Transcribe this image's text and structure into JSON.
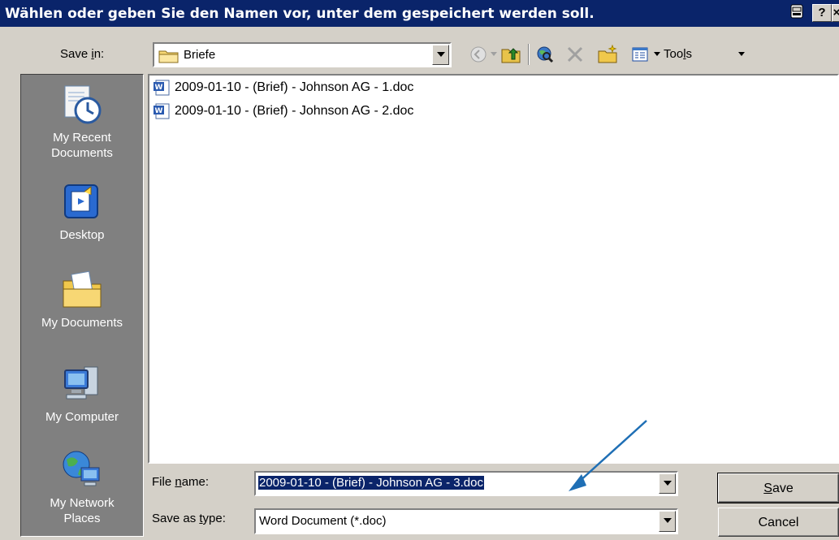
{
  "titlebar": {
    "title": "Wählen oder geben Sie den Namen vor, unter dem gespeichert werden soll.",
    "help_label": "?",
    "close_label": "×"
  },
  "save_in": {
    "label_pre": "Save ",
    "label_ul": "i",
    "label_post": "n:",
    "value": "Briefe"
  },
  "toolbar": {
    "tools_pre": "Too",
    "tools_ul": "l",
    "tools_post": "s"
  },
  "places": [
    {
      "label_line1": "My Recent",
      "label_line2": "Documents",
      "icon": "recent-documents-icon"
    },
    {
      "label_line1": "Desktop",
      "label_line2": "",
      "icon": "desktop-icon"
    },
    {
      "label_line1": "My Documents",
      "label_line2": "",
      "icon": "my-documents-icon"
    },
    {
      "label_line1": "My Computer",
      "label_line2": "",
      "icon": "my-computer-icon"
    },
    {
      "label_line1": "My Network",
      "label_line2": "Places",
      "icon": "network-places-icon"
    }
  ],
  "files": [
    {
      "name": "2009-01-10  - (Brief) - Johnson AG - 1.doc",
      "icon": "word-document-icon"
    },
    {
      "name": "2009-01-10  - (Brief) - Johnson AG - 2.doc",
      "icon": "word-document-icon"
    }
  ],
  "filename": {
    "label_pre": "File ",
    "label_ul": "n",
    "label_post": "ame:",
    "value": "2009-01-10  - (Brief) - Johnson AG - 3.doc"
  },
  "filetype": {
    "label_pre": "Save as ",
    "label_ul": "t",
    "label_post": "ype:",
    "value": "Word Document (*.doc)"
  },
  "buttons": {
    "save_ul": "S",
    "save_rest": "ave",
    "cancel": "Cancel"
  },
  "colors": {
    "titlebar": "#0a246a",
    "annotation_arrow": "#1f6fb5"
  }
}
